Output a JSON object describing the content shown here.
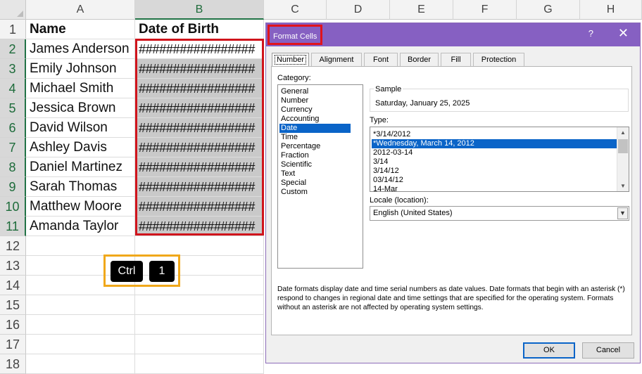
{
  "sheet": {
    "columns": [
      "A",
      "B",
      "C",
      "D",
      "E",
      "F",
      "G",
      "H"
    ],
    "rows": [
      "1",
      "2",
      "3",
      "4",
      "5",
      "6",
      "7",
      "8",
      "9",
      "10",
      "11",
      "12",
      "13",
      "14",
      "15",
      "16",
      "17",
      "18"
    ],
    "header": {
      "name": "Name",
      "dob": "Date of Birth"
    },
    "names": [
      "James Anderson",
      "Emily Johnson",
      "Michael Smith",
      "Jessica Brown",
      "David Wilson",
      "Ashley Davis",
      "Daniel Martinez",
      "Sarah Thomas",
      "Matthew Moore",
      "Amanda Taylor"
    ],
    "hash": "#################"
  },
  "shortcut": {
    "key1": "Ctrl",
    "key2": "1"
  },
  "dialog": {
    "title": "Format Cells",
    "help": "?",
    "close": "✕",
    "tabs": [
      "Number",
      "Alignment",
      "Font",
      "Border",
      "Fill",
      "Protection"
    ],
    "category_label": "Category:",
    "categories": [
      "General",
      "Number",
      "Currency",
      "Accounting",
      "Date",
      "Time",
      "Percentage",
      "Fraction",
      "Scientific",
      "Text",
      "Special",
      "Custom"
    ],
    "selected_category": "Date",
    "sample_label": "Sample",
    "sample_value": "Saturday, January 25, 2025",
    "type_label": "Type:",
    "types": [
      "*3/14/2012",
      "*Wednesday, March 14, 2012",
      "2012-03-14",
      "3/14",
      "3/14/12",
      "03/14/12",
      "14-Mar"
    ],
    "selected_type": "*Wednesday, March 14, 2012",
    "locale_label": "Locale (location):",
    "locale_value": "English (United States)",
    "description": "Date formats display date and time serial numbers as date values.  Date formats that begin with an asterisk (*) respond to changes in regional date and time settings that are specified for the operating system. Formats without an asterisk are not affected by operating system settings.",
    "ok": "OK",
    "cancel": "Cancel"
  },
  "colors": {
    "title_bar": "#8660c2",
    "highlight_red": "#d0141c",
    "shortcut_outline": "#f0a81b",
    "selection_blue": "#0a64c8",
    "excel_green": "#217346"
  }
}
